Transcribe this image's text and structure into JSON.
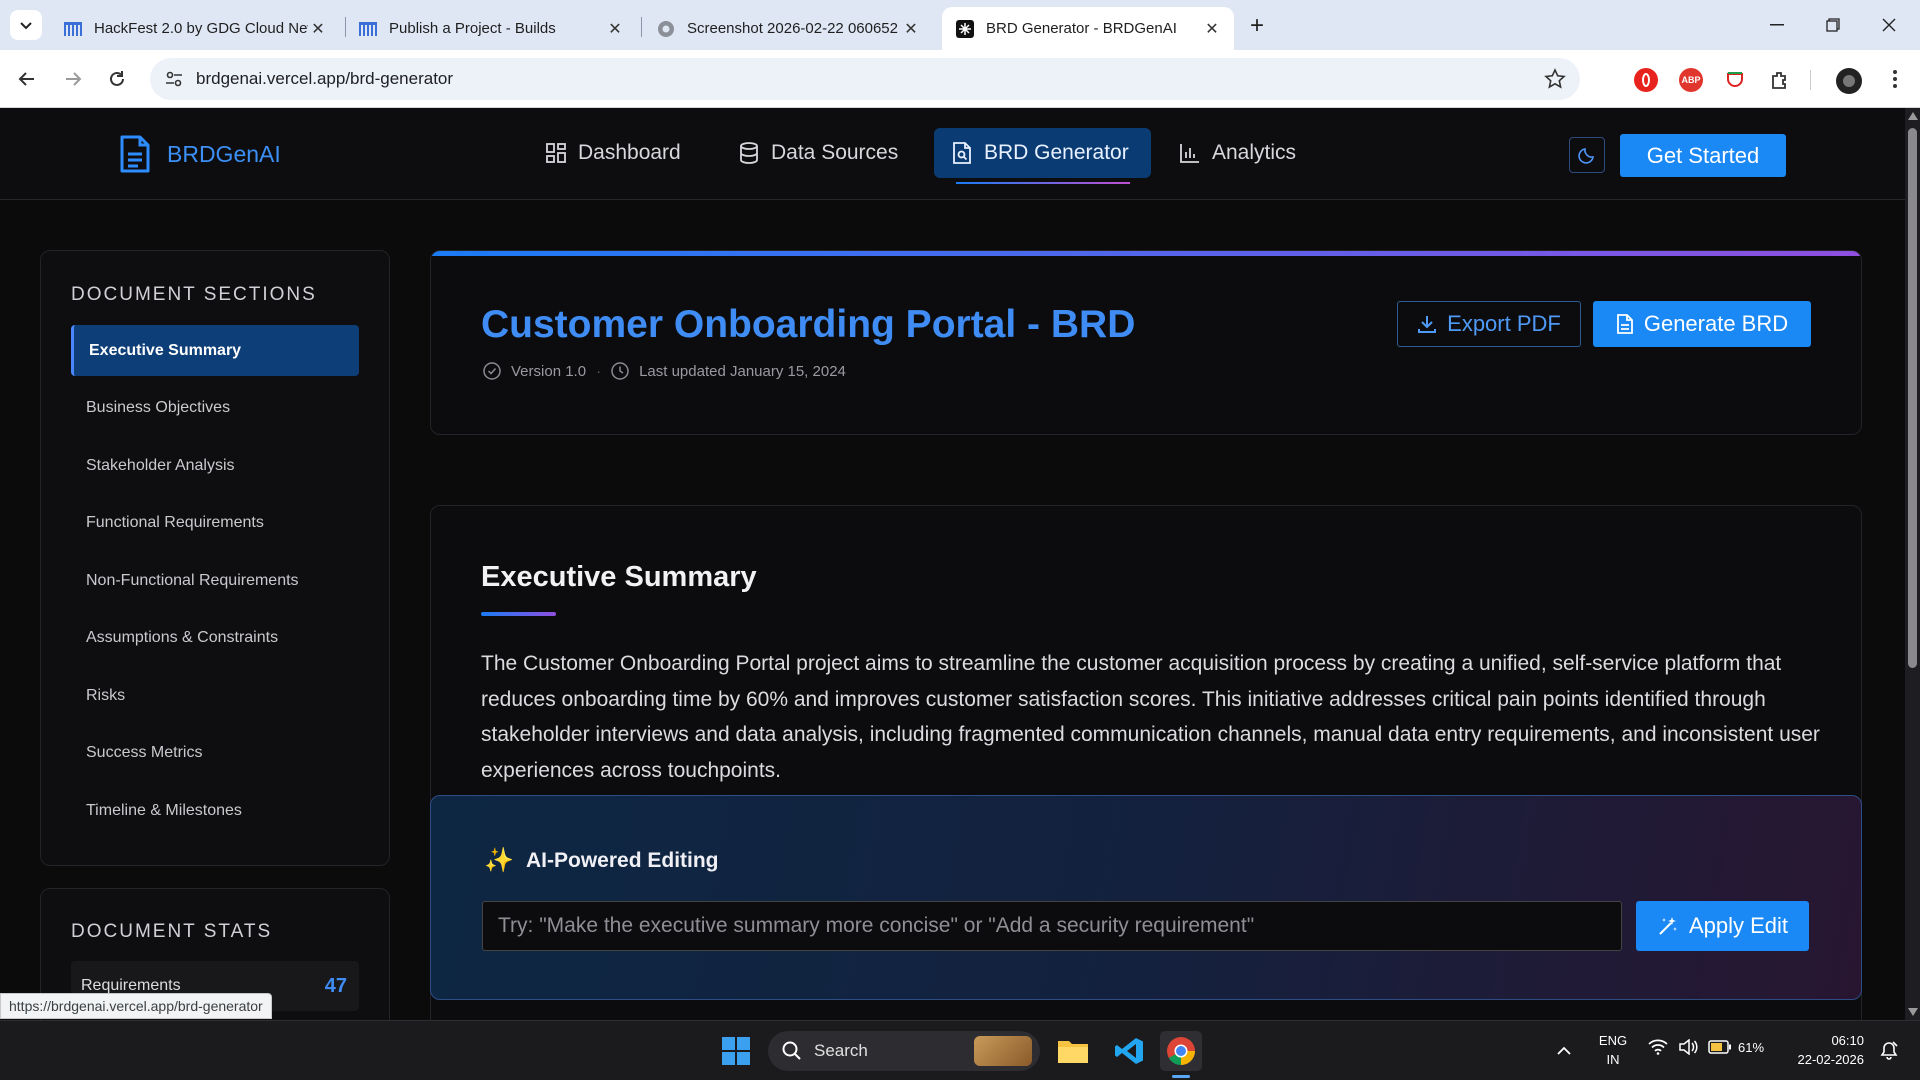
{
  "browser": {
    "tabs": [
      {
        "title": "HackFest 2.0 by GDG Cloud New Delhi",
        "icon": "hackfest-icon"
      },
      {
        "title": "Publish a Project - Builds",
        "icon": "builds-icon"
      },
      {
        "title": "Screenshot 2026-02-22 060652",
        "icon": "globe-icon"
      },
      {
        "title": "BRD Generator - BRDGenAI",
        "icon": "brdgenai-favicon",
        "active": true
      }
    ],
    "url": "brdgenai.vercel.app/brd-generator",
    "status_url": "https://brdgenai.vercel.app/brd-generator"
  },
  "app": {
    "brand": "BRDGenAI",
    "nav": [
      {
        "label": "Dashboard",
        "icon": "grid-icon"
      },
      {
        "label": "Data Sources",
        "icon": "database-icon"
      },
      {
        "label": "BRD Generator",
        "icon": "document-icon",
        "active": true
      },
      {
        "label": "Analytics",
        "icon": "bar-chart-icon"
      }
    ],
    "cta_label": "Get Started",
    "accent": "#1a88f5"
  },
  "sidebar": {
    "heading": "DOCUMENT SECTIONS",
    "items": [
      {
        "label": "Executive Summary",
        "active": true
      },
      {
        "label": "Business Objectives"
      },
      {
        "label": "Stakeholder Analysis"
      },
      {
        "label": "Functional Requirements"
      },
      {
        "label": "Non-Functional Requirements"
      },
      {
        "label": "Assumptions & Constraints"
      },
      {
        "label": "Risks"
      },
      {
        "label": "Success Metrics"
      },
      {
        "label": "Timeline & Milestones"
      }
    ]
  },
  "stats": {
    "heading": "DOCUMENT STATS",
    "rows": [
      {
        "label": "Requirements",
        "value": "47"
      }
    ]
  },
  "document": {
    "title": "Customer Onboarding Portal - BRD",
    "version": "Version 1.0",
    "meta_separator": "·",
    "updated": "Last updated January 15, 2024",
    "export_label": "Export PDF",
    "generate_label": "Generate BRD"
  },
  "summary": {
    "title": "Executive Summary",
    "body": "The Customer Onboarding Portal project aims to streamline the customer acquisition process by creating a unified, self-service platform that reduces onboarding time by 60% and improves customer satisfaction scores. This initiative addresses critical pain points identified through stakeholder interviews and data analysis, including fragmented communication channels, manual data entry requirements, and inconsistent user experiences across touchpoints."
  },
  "ai_editing": {
    "icon": "✨",
    "title": "AI-Powered Editing",
    "placeholder": "Try: \"Make the executive summary more concise\" or \"Add a security requirement\"",
    "apply_label": "Apply Edit"
  },
  "taskbar": {
    "search_label": "Search",
    "lang_line1": "ENG",
    "lang_line2": "IN",
    "battery": "61%",
    "time": "06:10",
    "date": "22-02-2026"
  }
}
